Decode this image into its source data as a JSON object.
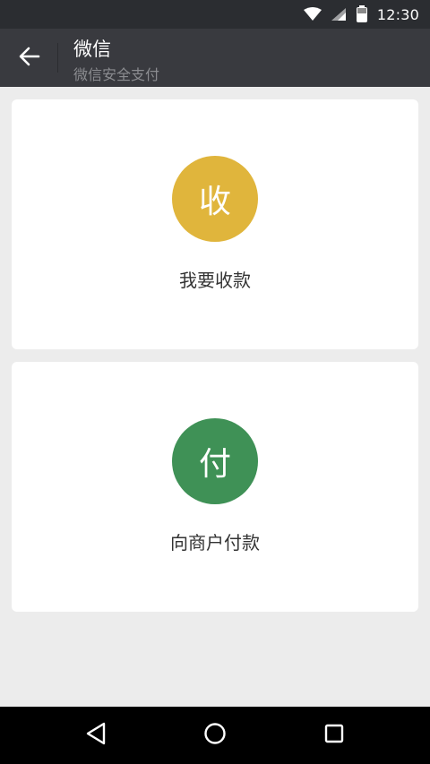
{
  "statusbar": {
    "time": "12:30",
    "icons": [
      "wifi-icon",
      "signal-icon",
      "battery-icon"
    ]
  },
  "appbar": {
    "title": "微信",
    "subtitle": "微信安全支付",
    "back_icon": "back-arrow-icon"
  },
  "cards": [
    {
      "glyph": "收",
      "label": "我要收款",
      "color": "#e0b53c"
    },
    {
      "glyph": "付",
      "label": "向商户付款",
      "color": "#3f9156"
    }
  ],
  "navbar": {
    "icons": [
      "back-triangle-icon",
      "home-circle-icon",
      "recents-square-icon"
    ]
  },
  "colors": {
    "statusbar_bg": "#2b2d31",
    "appbar_bg": "#393a3f",
    "page_bg": "#ececec",
    "card_bg": "#ffffff"
  }
}
